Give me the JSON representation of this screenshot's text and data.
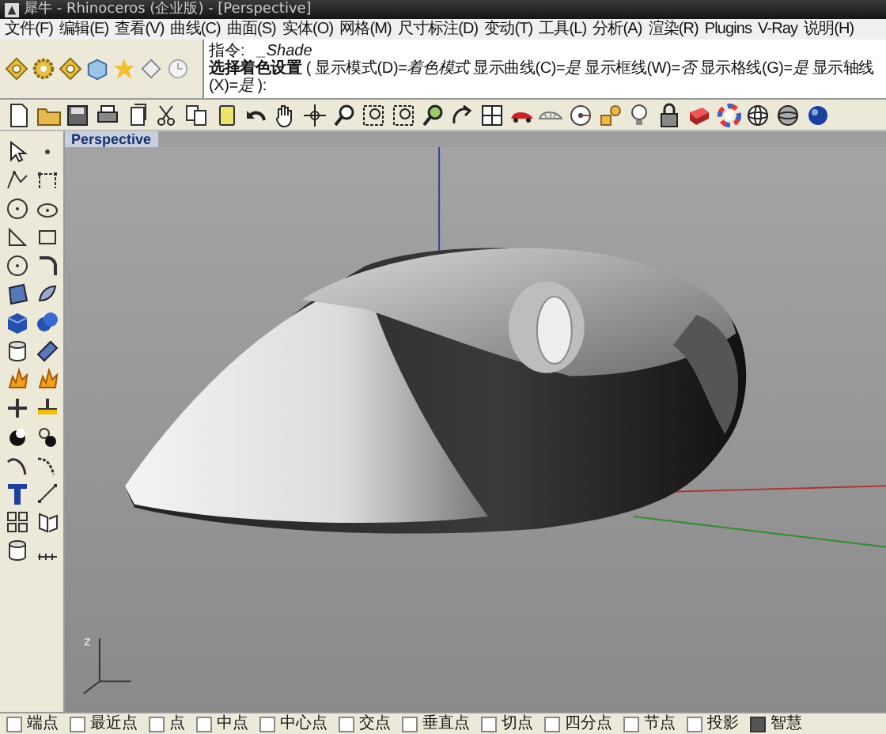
{
  "window": {
    "title": "犀牛 - Rhinoceros (企业版) - [Perspective]"
  },
  "menu": [
    {
      "label": "文件(F)"
    },
    {
      "label": "编辑(E)"
    },
    {
      "label": "查看(V)"
    },
    {
      "label": "曲线(C)"
    },
    {
      "label": "曲面(S)"
    },
    {
      "label": "实体(O)"
    },
    {
      "label": "网格(M)"
    },
    {
      "label": "尺寸标注(D)"
    },
    {
      "label": "变动(T)"
    },
    {
      "label": "工具(L)"
    },
    {
      "label": "分析(A)"
    },
    {
      "label": "渲染(R)"
    },
    {
      "label": "Plugins"
    },
    {
      "label": "V-Ray"
    },
    {
      "label": "说明(H)"
    }
  ],
  "command": {
    "prompt": "指令:",
    "value": "_Shade",
    "options": "**选择着色设置** ( 显示模式(D)=*着色模式* 显示曲线(C)=*是* 显示框线(W)=*否* 显示格线(G)=*是* 显示轴线(X)=*是* ):"
  },
  "viewport": {
    "title": "Perspective",
    "axis_label": "z"
  },
  "osnaps": [
    {
      "label": "端点",
      "checked": false
    },
    {
      "label": "最近点",
      "checked": false
    },
    {
      "label": "点",
      "checked": false
    },
    {
      "label": "中点",
      "checked": false
    },
    {
      "label": "中心点",
      "checked": false
    },
    {
      "label": "交点",
      "checked": false
    },
    {
      "label": "垂直点",
      "checked": false
    },
    {
      "label": "切点",
      "checked": false
    },
    {
      "label": "四分点",
      "checked": false
    },
    {
      "label": "节点",
      "checked": false
    },
    {
      "label": "投影",
      "checked": false
    },
    {
      "label": "智慧",
      "checked": true
    }
  ]
}
